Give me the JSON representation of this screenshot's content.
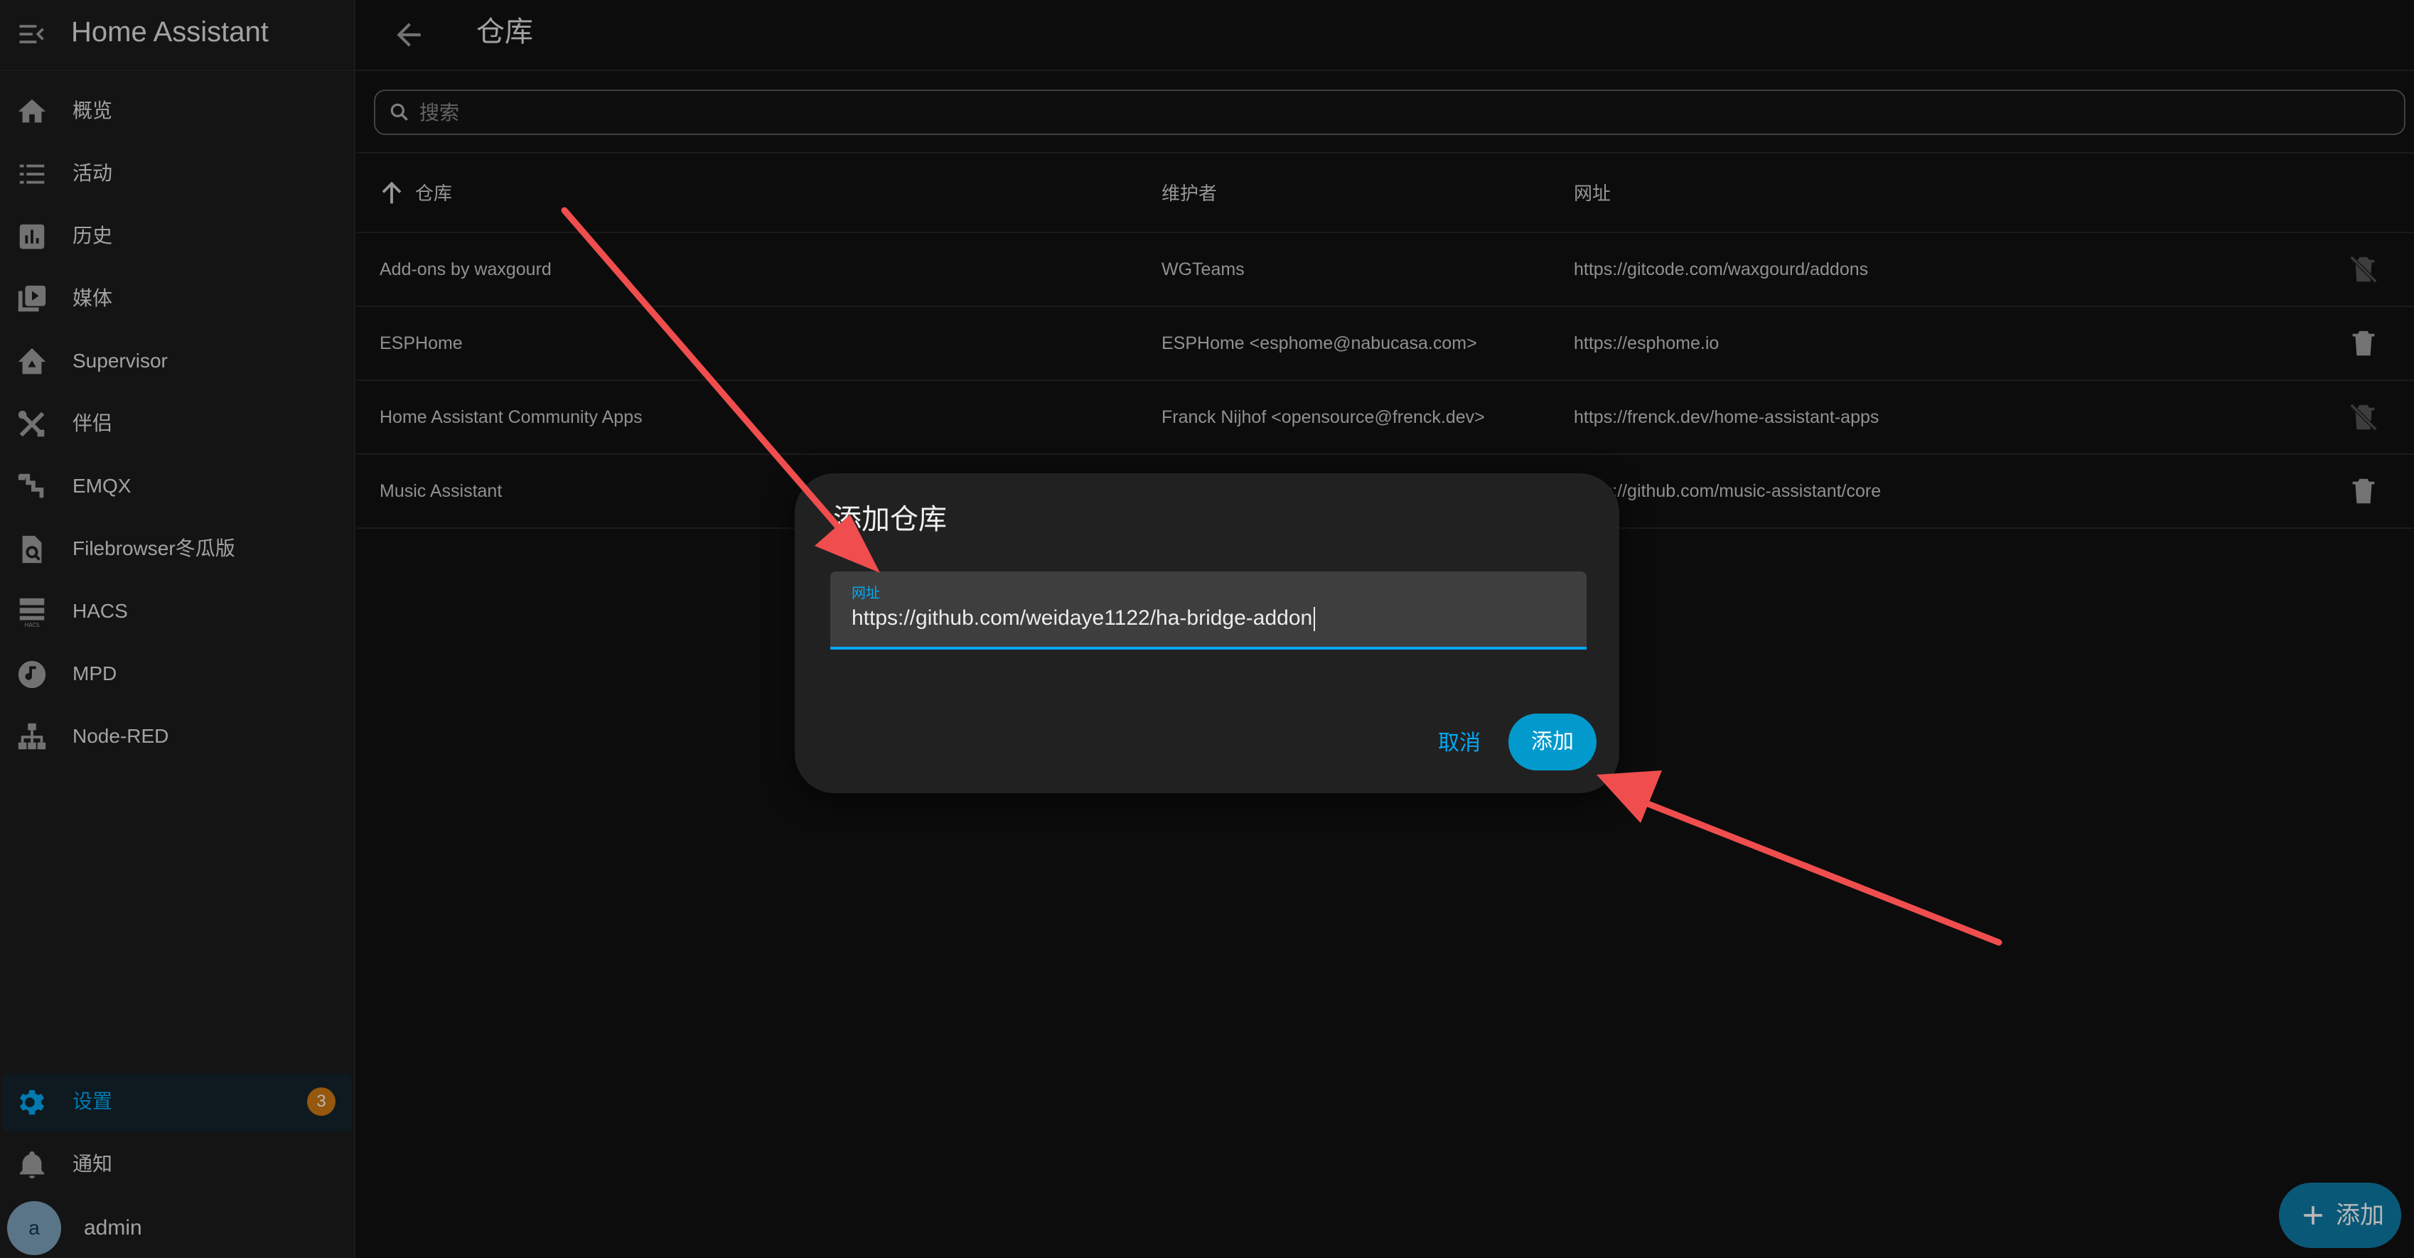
{
  "app": {
    "title": "Home Assistant"
  },
  "colors": {
    "accent": "#03a9f4",
    "badge": "#d07a12",
    "annotation_arrow": "#f04e4e"
  },
  "sidebar": {
    "items": [
      {
        "label": "概览",
        "icon": "home-icon"
      },
      {
        "label": "活动",
        "icon": "list-icon"
      },
      {
        "label": "历史",
        "icon": "chart-box-icon"
      },
      {
        "label": "媒体",
        "icon": "play-box-icon"
      },
      {
        "label": "Supervisor",
        "icon": "supervisor-icon"
      },
      {
        "label": "伴侣",
        "icon": "tools-icon"
      },
      {
        "label": "EMQX",
        "icon": "emqx-icon"
      },
      {
        "label": "Filebrowser冬瓜版",
        "icon": "file-search-icon"
      },
      {
        "label": "HACS",
        "icon": "hacs-icon"
      },
      {
        "label": "MPD",
        "icon": "music-disc-icon"
      },
      {
        "label": "Node-RED",
        "icon": "sitemap-icon"
      }
    ],
    "settings": {
      "label": "设置",
      "badge": "3"
    },
    "notifications": {
      "label": "通知"
    },
    "user": {
      "avatar": "a",
      "name": "admin"
    }
  },
  "header": {
    "title": "仓库"
  },
  "search": {
    "placeholder": "搜索",
    "value": ""
  },
  "table": {
    "columns": [
      "仓库",
      "维护者",
      "网址"
    ],
    "rows": [
      {
        "name": "Add-ons by waxgourd",
        "maintainer": "WGTeams",
        "url": "https://gitcode.com/waxgourd/addons",
        "deletable": false
      },
      {
        "name": "ESPHome",
        "maintainer": "ESPHome <esphome@nabucasa.com>",
        "url": "https://esphome.io",
        "deletable": true
      },
      {
        "name": "Home Assistant Community Apps",
        "maintainer": "Franck Nijhof <opensource@frenck.dev>",
        "url": "https://frenck.dev/home-assistant-apps",
        "deletable": false
      },
      {
        "name": "Music Assistant",
        "maintainer": "",
        "url": "https://github.com/music-assistant/core",
        "deletable": true
      }
    ]
  },
  "dialog": {
    "title": "添加仓库",
    "field_label": "网址",
    "field_value": "https://github.com/weidaye1122/ha-bridge-addon",
    "cancel_label": "取消",
    "add_label": "添加"
  },
  "fab": {
    "label": "添加"
  }
}
